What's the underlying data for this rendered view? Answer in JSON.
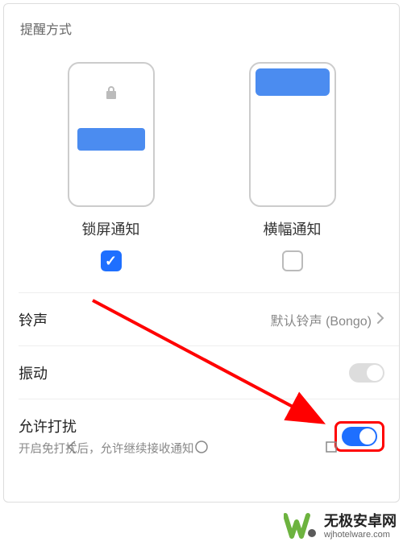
{
  "section_title": "提醒方式",
  "styles": {
    "lock": {
      "label": "锁屏通知",
      "checked": true
    },
    "banner": {
      "label": "横幅通知",
      "checked": false
    }
  },
  "ringtone": {
    "label": "铃声",
    "value": "默认铃声 (Bongo)"
  },
  "vibrate": {
    "label": "振动",
    "enabled": false
  },
  "allow_disturb": {
    "label": "允许打扰",
    "description": "开启免打扰后，允许继续接收通知",
    "enabled": true
  },
  "watermark": {
    "title": "无极安卓网",
    "url": "wjhotelware.com"
  }
}
